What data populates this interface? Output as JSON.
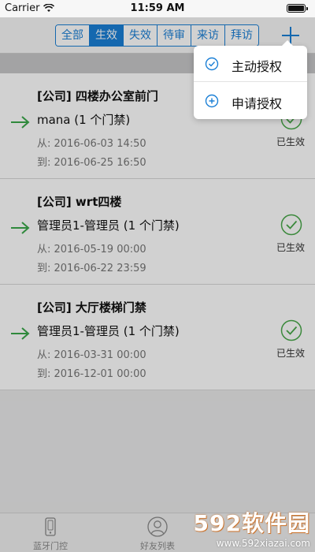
{
  "status_bar": {
    "carrier": "Carrier",
    "time": "11:59 AM"
  },
  "nav": {
    "segments": [
      "全部",
      "生效",
      "失效",
      "待审",
      "来访",
      "拜访"
    ],
    "active_segment": "生效"
  },
  "popup": {
    "items": [
      {
        "label": "主动授权",
        "icon": "check-circle-icon"
      },
      {
        "label": "申请授权",
        "icon": "plus-circle-icon"
      }
    ]
  },
  "items": [
    {
      "title": "[公司] 四楼办公室前门",
      "subtitle": "mana (1 个门禁)",
      "from": "从: 2016-06-03 14:50",
      "to": "到: 2016-06-25 16:50",
      "status": "已生效"
    },
    {
      "title": "[公司] wrt四楼",
      "subtitle": "管理员1-管理员 (1 个门禁)",
      "from": "从: 2016-05-19 00:00",
      "to": "到: 2016-06-22 23:59",
      "status": "已生效"
    },
    {
      "title": "[公司] 大厅楼梯门禁",
      "subtitle": "管理员1-管理员 (1 个门禁)",
      "from": "从: 2016-03-31 00:00",
      "to": "到: 2016-12-01 00:00",
      "status": "已生效"
    }
  ],
  "tabs": [
    {
      "label": "蓝牙门控",
      "icon": "bluetooth-door-icon"
    },
    {
      "label": "好友列表",
      "icon": "user-icon"
    }
  ],
  "watermark": {
    "logo": "592软件园",
    "url": "www.592xiazai.com"
  },
  "colors": {
    "accent": "#1a7fd6",
    "arrow_green": "#3aa84a",
    "check_green": "#49a84a"
  }
}
